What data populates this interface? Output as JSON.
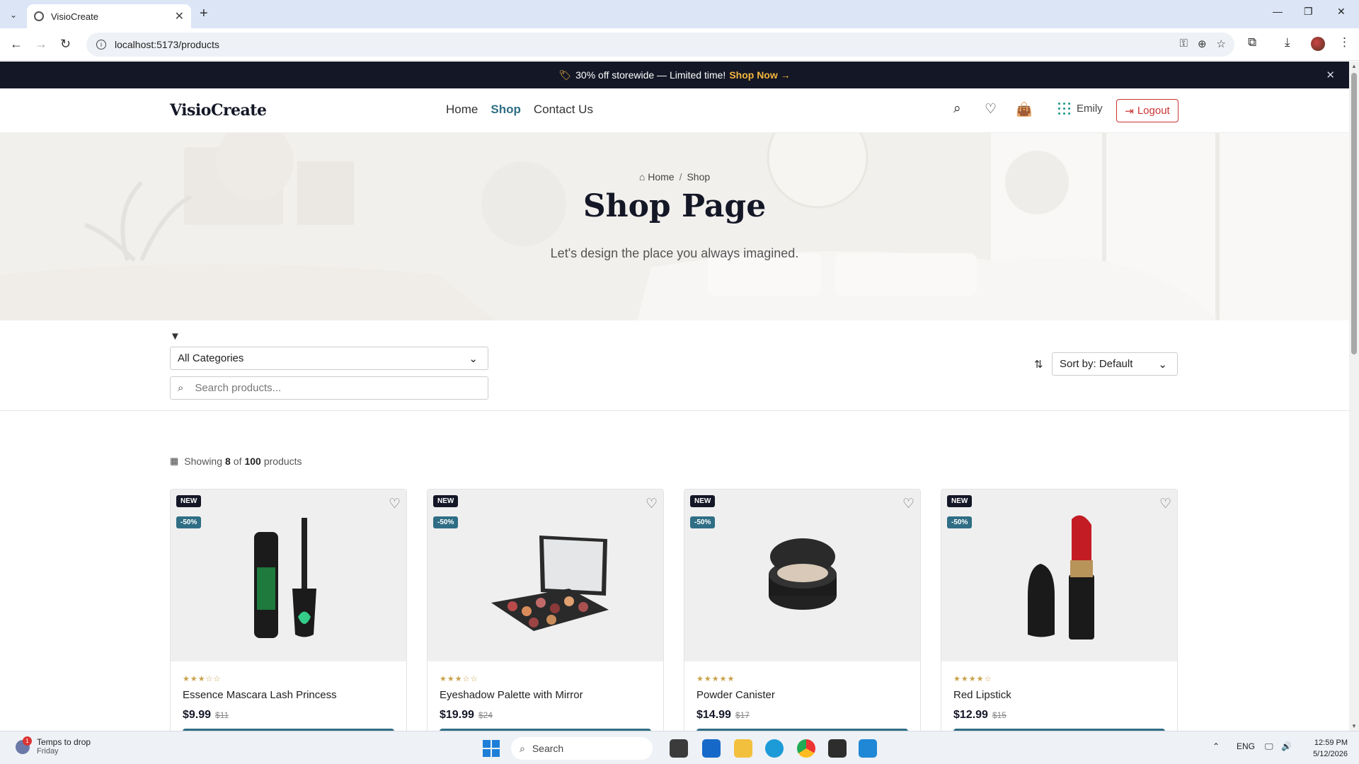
{
  "browser": {
    "tab_title": "VisioCreate",
    "url": "localhost:5173/products"
  },
  "announcement": {
    "text": "30% off storewide — Limited time!",
    "cta": "Shop Now →"
  },
  "header": {
    "brand": "VisioCreate",
    "nav": [
      "Home",
      "Shop",
      "Contact Us"
    ],
    "active_nav": "Shop",
    "user_name": "Emily",
    "logout_label": "Logout"
  },
  "hero": {
    "breadcrumb": [
      "Home",
      "Shop"
    ],
    "title": "Shop Page",
    "subtitle": "Let's design the place you always imagined."
  },
  "filters": {
    "category_value": "All Categories",
    "search_placeholder": "Search products...",
    "sort_value": "Sort by: Default"
  },
  "results": {
    "prefix": "Showing",
    "shown": "8",
    "middle": "of",
    "total": "100",
    "suffix": "products"
  },
  "products": [
    {
      "name": "Essence Mascara Lash Princess",
      "price": "$9.99",
      "old_price": "$11",
      "badge_new": "NEW",
      "badge_discount": "-50%",
      "stars": "★★★☆☆",
      "rating": 3
    },
    {
      "name": "Eyeshadow Palette with Mirror",
      "price": "$19.99",
      "old_price": "$24",
      "badge_new": "NEW",
      "badge_discount": "-50%",
      "stars": "★★★☆☆",
      "rating": 3
    },
    {
      "name": "Powder Canister",
      "price": "$14.99",
      "old_price": "$17",
      "badge_new": "NEW",
      "badge_discount": "-50%",
      "stars": "★★★★★",
      "rating": 5
    },
    {
      "name": "Red Lipstick",
      "price": "$12.99",
      "old_price": "$15",
      "badge_new": "NEW",
      "badge_discount": "-50%",
      "stars": "★★★★☆",
      "rating": 4
    }
  ],
  "taskbar": {
    "weather_title": "Temps to drop",
    "weather_sub": "Friday",
    "notification_count": "1",
    "search_label": "Search",
    "language": "ENG",
    "time": "12:59 PM",
    "date": "5/12/2026"
  },
  "colors": {
    "accent": "#2f6e85",
    "dark": "#141726",
    "promo": "#f4b63c",
    "logout": "#cc3333"
  }
}
